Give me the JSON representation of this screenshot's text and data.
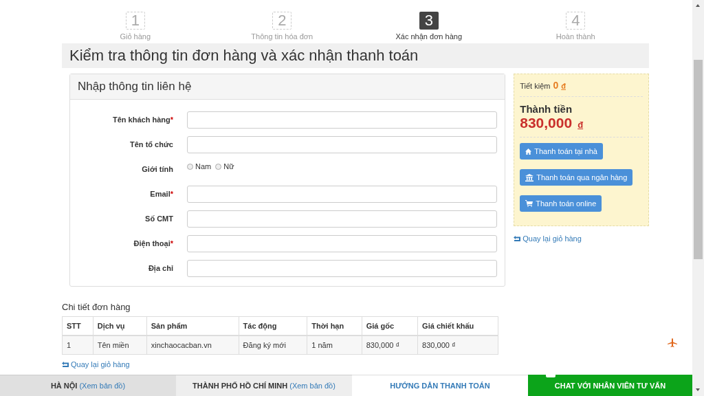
{
  "steps": [
    {
      "number": "1",
      "label": "Giỏ hàng",
      "selected": false
    },
    {
      "number": "2",
      "label": "Thông tin hóa đơn",
      "selected": false
    },
    {
      "number": "3",
      "label": "Xác nhận đơn hàng",
      "selected": true
    },
    {
      "number": "4",
      "label": "Hoàn thành",
      "selected": false
    }
  ],
  "page_title": "Kiểm tra thông tin đơn hàng và xác nhận thanh toán",
  "contact_form": {
    "title": "Nhập thông tin liên hệ",
    "fields": [
      {
        "kind": "text",
        "label": "Tên khách hàng",
        "required_mark": "*"
      },
      {
        "kind": "text",
        "label": "Tên tổ chức"
      },
      {
        "kind": "radio",
        "label": "Giới tính",
        "options": [
          {
            "label": "Nam",
            "selected": false
          },
          {
            "label": "Nữ",
            "selected": false
          }
        ]
      },
      {
        "kind": "text",
        "label": "Email",
        "required_mark": "*"
      },
      {
        "kind": "text",
        "label": "Số CMT"
      },
      {
        "kind": "text",
        "label": "Điện thoại",
        "required_mark": "*"
      },
      {
        "kind": "text",
        "label": "Địa chỉ"
      }
    ]
  },
  "summary": {
    "savings_label": "Tiết kiệm",
    "savings_value": "0",
    "savings_currency": "đ",
    "total_label": "Thành tiền",
    "total_value": "830,000",
    "total_currency": "đ",
    "buttons": [
      {
        "kind": "home",
        "label": "Thanh toán tại nhà"
      },
      {
        "kind": "bank",
        "label": "Thanh toán qua ngân hàng"
      },
      {
        "kind": "cart",
        "label": "Thanh toán online"
      }
    ],
    "back_link": "Quay lại giỏ hàng"
  },
  "order_details": {
    "title": "Chi tiết đơn hàng",
    "table": {
      "columns": [
        "STT",
        "Dịch vụ",
        "Sản phẩm",
        "Tác động",
        "Thời hạn",
        "Giá gốc",
        "Giá chiết khấu"
      ],
      "rows": [
        [
          "1",
          "Tên miền",
          "xinchaocacban.vn",
          "Đăng ký mới",
          "1 năm",
          "830,000 ₫",
          "830,000 ₫"
        ]
      ]
    },
    "back_link": "Quay lại giỏ hàng"
  },
  "bottom_bar": [
    {
      "kind": "city",
      "label": "HÀ NỘI",
      "link": "(Xem bản đồ)"
    },
    {
      "kind": "city",
      "label": "THÀNH PHỐ HỒ CHÍ MINH",
      "link": "(Xem bản đồ)"
    },
    {
      "kind": "guide",
      "label": "HƯỚNG DẪN THANH TOÁN"
    },
    {
      "kind": "chat",
      "label": "CHAT VỚI NHÂN VIÊN TƯ VẤN"
    }
  ]
}
